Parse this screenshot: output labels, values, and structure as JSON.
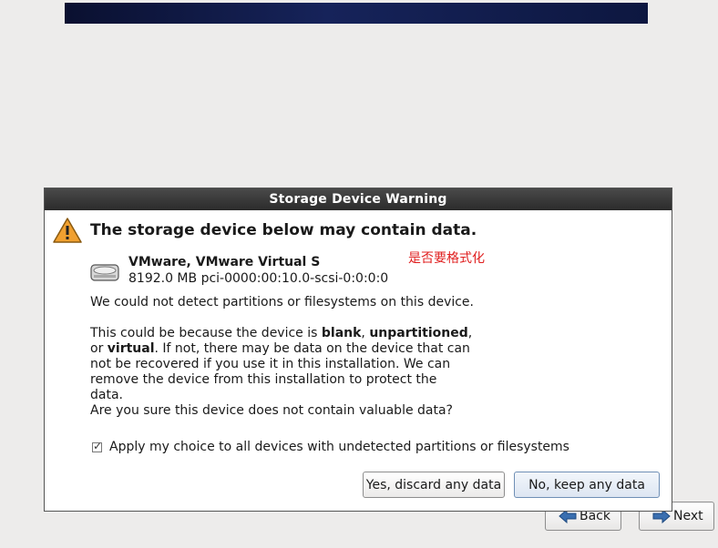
{
  "dialog": {
    "title": "Storage Device Warning",
    "heading": "The storage device below may contain data.",
    "device_name": "VMware, VMware Virtual S",
    "device_info": "8192.0 MB pci-0000:00:10.0-scsi-0:0:0:0",
    "annotation": "是否要格式化",
    "para1": "We could not detect partitions or filesystems on this device.",
    "para2_a": "This could be because the device is ",
    "para2_blank": "blank",
    "para2_comma": ", ",
    "para2_unpart": "unpartitioned",
    "para2_b": ",",
    "para2_or": "or ",
    "para2_virtual": "virtual",
    "para2_c": ". If not, there may be data on the device that can not be recovered if you use it in this installation. We can remove the device from this installation to protect the data.",
    "para3": "Are you sure this device does not contain valuable data?",
    "checkbox_label": "Apply my choice to all devices with undetected partitions or filesystems",
    "checkbox_checked": true,
    "yes_button": "Yes, discard any data",
    "no_button": "No, keep any data"
  },
  "nav": {
    "back_label": "Back",
    "next_label": "Next"
  },
  "icons": {
    "warning": "warning-icon",
    "drive": "hard-drive-icon",
    "back": "arrow-left-icon",
    "next": "arrow-right-icon"
  },
  "colors": {
    "annotation": "#e02020",
    "titlebar": "#333333",
    "banner": "#16235a"
  }
}
